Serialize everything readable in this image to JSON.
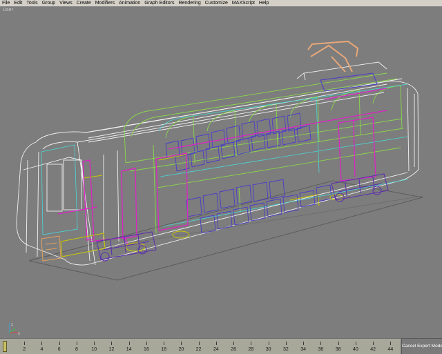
{
  "menu": [
    "File",
    "Edit",
    "Tools",
    "Group",
    "Views",
    "Create",
    "Modifiers",
    "Animation",
    "Graph Editors",
    "Rendering",
    "Customize",
    "MAXScript",
    "Help"
  ],
  "viewport": {
    "label": "User"
  },
  "axis": {
    "x": "x",
    "z": "z"
  },
  "timeline": {
    "ticks": [
      "2",
      "4",
      "6",
      "8",
      "10",
      "12",
      "14",
      "16",
      "18",
      "20",
      "22",
      "24",
      "26",
      "28",
      "30",
      "32",
      "34",
      "36",
      "38",
      "40",
      "42",
      "44"
    ]
  },
  "expert": {
    "label": "Cancel Expert Mode"
  },
  "colors": {
    "background": "#7d7d7d",
    "cage": "#ffffff",
    "frame": "#c8c800",
    "seats": "#4a3cc8",
    "trim": "#e020c8",
    "ribs": "#8ad84a"
  }
}
